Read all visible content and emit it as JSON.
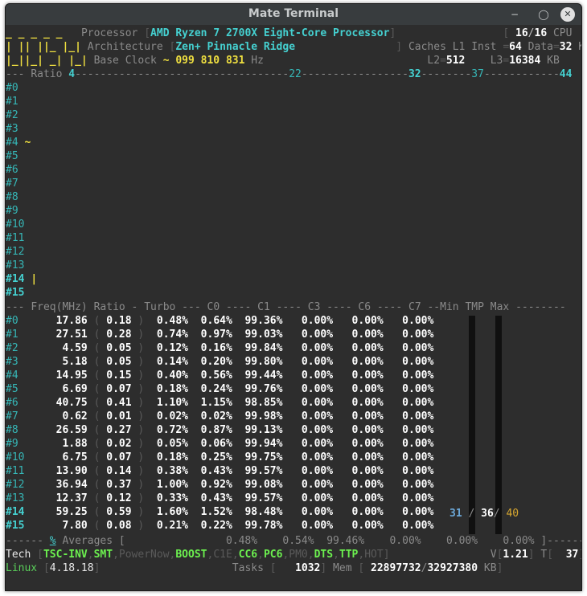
{
  "window": {
    "title": "Mate Terminal"
  },
  "header": {
    "logo": [
      "_ _ _ _ _",
      "| || ||_ |_|",
      "|_||_| _| |_|"
    ],
    "processor_label": "Processor",
    "processor_value": "AMD Ryzen 7 2700X Eight-Core Processor",
    "cpu_online": "16",
    "cpu_total": "16",
    "cpu_label": "CPU",
    "architecture_label": "Architecture",
    "architecture_value": "Zen+ Pinnacle Ridge",
    "caches_label": "Caches L1 Inst",
    "l1_inst": "64",
    "l1_data_label": "Data",
    "l1_data": "32",
    "kb": "KB",
    "base_clock_label": "Base Clock",
    "base_clock_value": "~ 099 810 831",
    "hz": "Hz",
    "l2_label": "L2",
    "l2": "512",
    "l3_label": "L3",
    "l3": "16384"
  },
  "ratio_ruler": {
    "label": "Ratio",
    "marks": [
      "4",
      "22",
      "32",
      "37",
      "44"
    ]
  },
  "cores": [
    "#0",
    "#1",
    "#2",
    "#3",
    "#4",
    "#5",
    "#6",
    "#7",
    "#8",
    "#9",
    "#10",
    "#11",
    "#12",
    "#13",
    "#14",
    "#15"
  ],
  "core_marks": {
    "4": "~",
    "14": "|"
  },
  "table": {
    "header": [
      "Freq(MHz)",
      "Ratio",
      "Turbo",
      "C0",
      "C1",
      "C3",
      "C6",
      "C7",
      "Min",
      "TMP",
      "Max"
    ],
    "rows": [
      [
        "#0",
        "17.86",
        "0.18",
        "0.48%",
        "0.64%",
        "99.36%",
        "0.00%",
        "0.00%",
        "0.00%"
      ],
      [
        "#1",
        "27.51",
        "0.28",
        "0.74%",
        "0.97%",
        "99.03%",
        "0.00%",
        "0.00%",
        "0.00%"
      ],
      [
        "#2",
        "4.59",
        "0.05",
        "0.12%",
        "0.16%",
        "99.84%",
        "0.00%",
        "0.00%",
        "0.00%"
      ],
      [
        "#3",
        "5.18",
        "0.05",
        "0.14%",
        "0.20%",
        "99.80%",
        "0.00%",
        "0.00%",
        "0.00%"
      ],
      [
        "#4",
        "14.95",
        "0.15",
        "0.40%",
        "0.56%",
        "99.44%",
        "0.00%",
        "0.00%",
        "0.00%"
      ],
      [
        "#5",
        "6.69",
        "0.07",
        "0.18%",
        "0.24%",
        "99.76%",
        "0.00%",
        "0.00%",
        "0.00%"
      ],
      [
        "#6",
        "40.75",
        "0.41",
        "1.10%",
        "1.15%",
        "98.85%",
        "0.00%",
        "0.00%",
        "0.00%"
      ],
      [
        "#7",
        "0.62",
        "0.01",
        "0.02%",
        "0.02%",
        "99.98%",
        "0.00%",
        "0.00%",
        "0.00%"
      ],
      [
        "#8",
        "26.59",
        "0.27",
        "0.72%",
        "0.87%",
        "99.13%",
        "0.00%",
        "0.00%",
        "0.00%"
      ],
      [
        "#9",
        "1.88",
        "0.02",
        "0.05%",
        "0.06%",
        "99.94%",
        "0.00%",
        "0.00%",
        "0.00%"
      ],
      [
        "#10",
        "6.75",
        "0.07",
        "0.18%",
        "0.25%",
        "99.75%",
        "0.00%",
        "0.00%",
        "0.00%"
      ],
      [
        "#11",
        "13.90",
        "0.14",
        "0.38%",
        "0.43%",
        "99.57%",
        "0.00%",
        "0.00%",
        "0.00%"
      ],
      [
        "#12",
        "36.94",
        "0.37",
        "1.00%",
        "0.92%",
        "99.08%",
        "0.00%",
        "0.00%",
        "0.00%"
      ],
      [
        "#13",
        "12.37",
        "0.12",
        "0.33%",
        "0.43%",
        "99.57%",
        "0.00%",
        "0.00%",
        "0.00%"
      ],
      [
        "#14",
        "59.25",
        "0.59",
        "1.60%",
        "1.52%",
        "98.48%",
        "0.00%",
        "0.00%",
        "0.00%"
      ],
      [
        "#15",
        "7.80",
        "0.08",
        "0.21%",
        "0.22%",
        "99.78%",
        "0.00%",
        "0.00%",
        "0.00%"
      ]
    ],
    "temp_min": "31",
    "temp_cur": "36",
    "temp_max": "40",
    "averages_label": "% Averages",
    "averages": [
      "0.48%",
      "0.54%",
      "99.46%",
      "0.00%",
      "0.00%",
      "0.00%"
    ]
  },
  "footer": {
    "tech_label": "Tech",
    "tech_flags": [
      {
        "name": "TSC-INV",
        "on": true
      },
      {
        "name": "SMT",
        "on": true
      },
      {
        "name": "PowerNow",
        "on": false
      },
      {
        "name": "BOOST",
        "on": true
      },
      {
        "name": "C1E",
        "on": false
      },
      {
        "name": "CC6",
        "on": true
      },
      {
        "name": "PC6",
        "on": true
      },
      {
        "name": "PM0",
        "on": false
      },
      {
        "name": "DTS",
        "on": true
      },
      {
        "name": "TTP",
        "on": true
      },
      {
        "name": "HOT",
        "on": false
      }
    ],
    "voltage_label": "V",
    "voltage": "1.21",
    "temp_label": "T",
    "temp": "37",
    "os": "Linux",
    "kernel": "4.18.18",
    "tasks_label": "Tasks",
    "tasks": "1032",
    "mem_label": "Mem",
    "mem_used": "22897732",
    "mem_total": "32927380",
    "mem_unit": "KB"
  },
  "colors": {
    "background": "#2d2d2d",
    "titlebar": "#383c3e",
    "cyan": "#45d1d1",
    "yellow": "#f0e040",
    "green": "#6cf04f"
  }
}
